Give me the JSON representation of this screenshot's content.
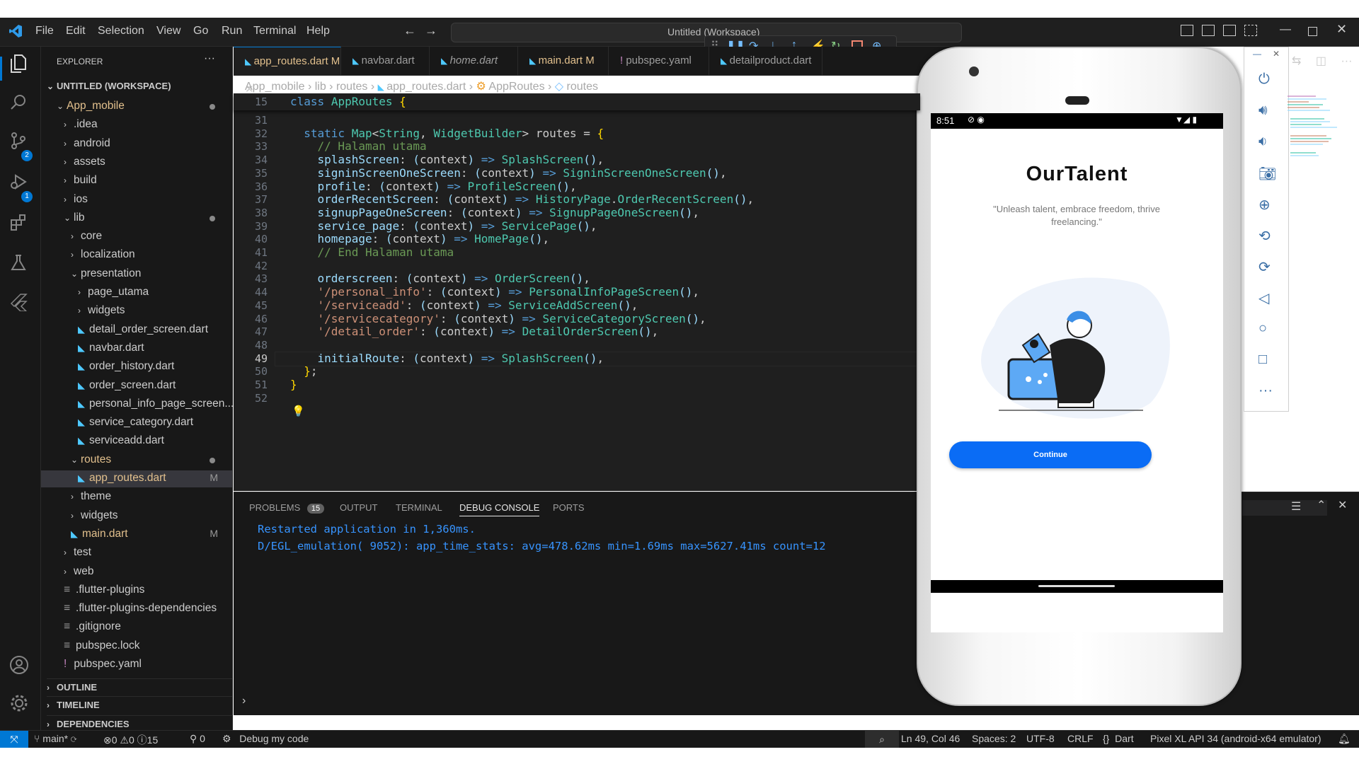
{
  "titlebar": {
    "menus": [
      "File",
      "Edit",
      "Selection",
      "View",
      "Go",
      "Run",
      "Terminal",
      "Help"
    ],
    "command_center": "Untitled (Workspace)"
  },
  "activity_badges": {
    "source_control": "2",
    "run_debug": "1"
  },
  "explorer": {
    "title": "EXPLORER",
    "workspace": "UNTITLED (WORKSPACE)",
    "items": [
      {
        "label": "App_mobile",
        "depth": 0,
        "kind": "folder-open",
        "mod": "dot",
        "color": "#e2c08d"
      },
      {
        "label": ".idea",
        "depth": 1,
        "kind": "folder"
      },
      {
        "label": "android",
        "depth": 1,
        "kind": "folder"
      },
      {
        "label": "assets",
        "depth": 1,
        "kind": "folder"
      },
      {
        "label": "build",
        "depth": 1,
        "kind": "folder"
      },
      {
        "label": "ios",
        "depth": 1,
        "kind": "folder"
      },
      {
        "label": "lib",
        "depth": 1,
        "kind": "folder-open",
        "mod": "dot"
      },
      {
        "label": "core",
        "depth": 2,
        "kind": "folder"
      },
      {
        "label": "localization",
        "depth": 2,
        "kind": "folder"
      },
      {
        "label": "presentation",
        "depth": 2,
        "kind": "folder-open"
      },
      {
        "label": "page_utama",
        "depth": 3,
        "kind": "folder"
      },
      {
        "label": "widgets",
        "depth": 3,
        "kind": "folder"
      },
      {
        "label": "detail_order_screen.dart",
        "depth": 3,
        "kind": "dart"
      },
      {
        "label": "navbar.dart",
        "depth": 3,
        "kind": "dart"
      },
      {
        "label": "order_history.dart",
        "depth": 3,
        "kind": "dart"
      },
      {
        "label": "order_screen.dart",
        "depth": 3,
        "kind": "dart"
      },
      {
        "label": "personal_info_page_screen....",
        "depth": 3,
        "kind": "dart"
      },
      {
        "label": "service_category.dart",
        "depth": 3,
        "kind": "dart"
      },
      {
        "label": "serviceadd.dart",
        "depth": 3,
        "kind": "dart"
      },
      {
        "label": "routes",
        "depth": 2,
        "kind": "folder-open",
        "mod": "dot",
        "color": "#e2c08d"
      },
      {
        "label": "app_routes.dart",
        "depth": 3,
        "kind": "dart",
        "mod": "M",
        "selected": true,
        "color": "#e2c08d"
      },
      {
        "label": "theme",
        "depth": 2,
        "kind": "folder"
      },
      {
        "label": "widgets",
        "depth": 2,
        "kind": "folder"
      },
      {
        "label": "main.dart",
        "depth": 2,
        "kind": "dart",
        "mod": "M",
        "color": "#e2c08d"
      },
      {
        "label": "test",
        "depth": 1,
        "kind": "folder"
      },
      {
        "label": "web",
        "depth": 1,
        "kind": "folder"
      },
      {
        "label": ".flutter-plugins",
        "depth": 1,
        "kind": "file"
      },
      {
        "label": ".flutter-plugins-dependencies",
        "depth": 1,
        "kind": "file"
      },
      {
        "label": ".gitignore",
        "depth": 1,
        "kind": "file"
      },
      {
        "label": "pubspec.lock",
        "depth": 1,
        "kind": "file"
      },
      {
        "label": "pubspec.yaml",
        "depth": 1,
        "kind": "yaml"
      }
    ],
    "sections": [
      "OUTLINE",
      "TIMELINE",
      "DEPENDENCIES"
    ]
  },
  "tabs": [
    {
      "label": "app_routes.dart",
      "mod": "M",
      "active": true
    },
    {
      "label": "navbar.dart"
    },
    {
      "label": "home.dart",
      "italic": true
    },
    {
      "label": "main.dart",
      "mod": "M"
    },
    {
      "label": "pubspec.yaml"
    },
    {
      "label": "detailproduct.dart"
    }
  ],
  "breadcrumb": [
    "App_mobile",
    "lib",
    "routes",
    "app_routes.dart",
    "AppRoutes",
    "routes"
  ],
  "editor": {
    "sticky_line": "15",
    "sticky_code": "class AppRoutes {",
    "lines": [
      {
        "n": "31",
        "code": ""
      },
      {
        "n": "32",
        "code": "  static Map<String, WidgetBuilder> routes = {"
      },
      {
        "n": "33",
        "code": "    // Halaman utama"
      },
      {
        "n": "34",
        "code": "    splashScreen: (context) => SplashScreen(),"
      },
      {
        "n": "35",
        "code": "    signinScreenOneScreen: (context) => SigninScreenOneScreen(),"
      },
      {
        "n": "36",
        "code": "    profile: (context) => ProfileScreen(),"
      },
      {
        "n": "37",
        "code": "    orderRecentScreen: (context) => HistoryPage.OrderRecentScreen(),"
      },
      {
        "n": "38",
        "code": "    signupPageOneScreen: (context) => SignupPageOneScreen(),"
      },
      {
        "n": "39",
        "code": "    service_page: (context) => ServicePage(),"
      },
      {
        "n": "40",
        "code": "    homepage: (context) => HomePage(),"
      },
      {
        "n": "41",
        "code": "    // End Halaman utama"
      },
      {
        "n": "42",
        "code": ""
      },
      {
        "n": "43",
        "code": "    orderscreen: (context) => OrderScreen(),"
      },
      {
        "n": "44",
        "code": "    '/personal_info': (context) => PersonalInfoPageScreen(),"
      },
      {
        "n": "45",
        "code": "    '/serviceadd': (context) => ServiceAddScreen(),"
      },
      {
        "n": "46",
        "code": "    '/servicecategory': (context) => ServiceCategoryScreen(),"
      },
      {
        "n": "47",
        "code": "    '/detail_order': (context) => DetailOrderScreen(),"
      },
      {
        "n": "48",
        "code": ""
      },
      {
        "n": "49",
        "code": "    initialRoute: (context) => SplashScreen(),"
      },
      {
        "n": "50",
        "code": "  };"
      },
      {
        "n": "51",
        "code": "}"
      },
      {
        "n": "52",
        "code": ""
      }
    ]
  },
  "panel": {
    "tabs": [
      "PROBLEMS",
      "OUTPUT",
      "TERMINAL",
      "DEBUG CONSOLE",
      "PORTS"
    ],
    "problems_count": "15",
    "active_tab": "DEBUG CONSOLE",
    "console": [
      "Restarted application in 1,360ms.",
      "D/EGL_emulation( 9052): app_time_stats: avg=478.62ms min=1.69ms max=5627.41ms count=12"
    ]
  },
  "statusbar": {
    "branch": "main*",
    "errors": "0",
    "warnings": "0",
    "infos": "15",
    "ports": "0",
    "debug": "Debug my code",
    "position": "Ln 49, Col 46",
    "spaces": "Spaces: 2",
    "encoding": "UTF-8",
    "eol": "CRLF",
    "language": "Dart",
    "device": "Pixel XL API 34 (android-x64 emulator)"
  },
  "phone": {
    "time": "8:51",
    "title": "OurTalent",
    "subtitle": "\"Unleash talent, embrace freedom, thrive freelancing.\"",
    "button": "Continue",
    "accent": "#0a6cf5"
  },
  "colors": {
    "accent": "#0078d4",
    "editor_bg": "#1f1f1f",
    "sidebar_bg": "#181818"
  }
}
